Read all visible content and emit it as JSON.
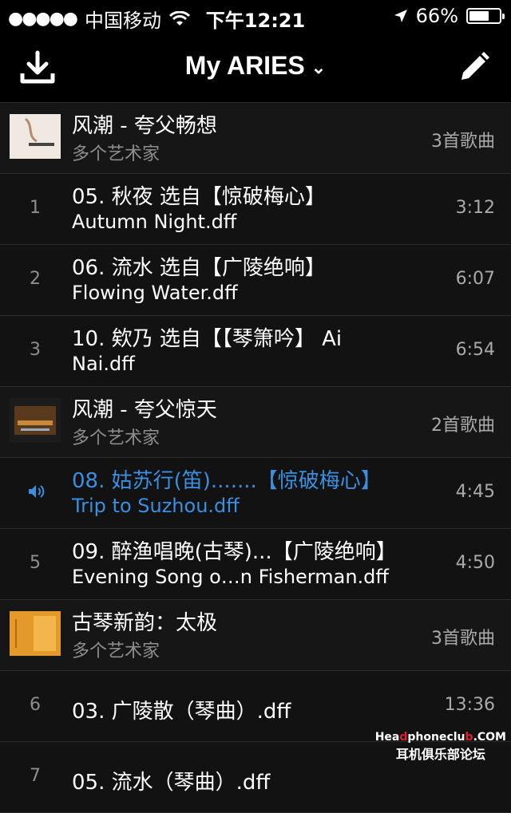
{
  "status": {
    "signal_dots": "●●●●●",
    "carrier": "中国移动",
    "time": "下午12:21",
    "battery": "66%",
    "battery_level": 0.66
  },
  "nav": {
    "title": "My ARIES"
  },
  "albums": [
    {
      "title": "风潮 - 夸父畅想",
      "artist": "多个艺术家",
      "count": "3首歌曲"
    },
    {
      "title": "风潮 - 夸父惊天",
      "artist": "多个艺术家",
      "count": "2首歌曲"
    },
    {
      "title": "古琴新韵：太极",
      "artist": "多个艺术家",
      "count": "3首歌曲"
    }
  ],
  "tracks": [
    {
      "num": "1",
      "line1": "05. 秋夜 选自【惊破梅心】",
      "line2": "Autumn Night.dff",
      "duration": "3:12"
    },
    {
      "num": "2",
      "line1": "06. 流水 选自【广陵绝响】",
      "line2": "Flowing Water.dff",
      "duration": "6:07"
    },
    {
      "num": "3",
      "line1": "10. 欸乃 选自【【琴箫吟】 Ai",
      "line2": "Nai.dff",
      "duration": "6:54"
    },
    {
      "num": "",
      "line1": "08. 姑苏行(笛).......【惊破梅心】",
      "line2": "Trip to Suzhou.dff",
      "duration": "4:45"
    },
    {
      "num": "5",
      "line1": "09. 醉渔唱晚(古琴)...【广陵绝响】",
      "line2": "Evening Song o…n Fisherman.dff",
      "duration": "4:50"
    },
    {
      "num": "6",
      "line1": "03. 广陵散（琴曲）.dff",
      "duration": "13:36"
    },
    {
      "num": "7",
      "line1": "05. 流水（琴曲）.dff"
    }
  ],
  "watermark": {
    "line1_a": "Hea",
    "line1_b": "d",
    "line1_c": "phoneclu",
    "line1_d": "b",
    "line1_e": ".COM",
    "line2": "耳机俱乐部论坛"
  },
  "colors": {
    "accent": "#3b8fe0",
    "background": "#171717"
  }
}
